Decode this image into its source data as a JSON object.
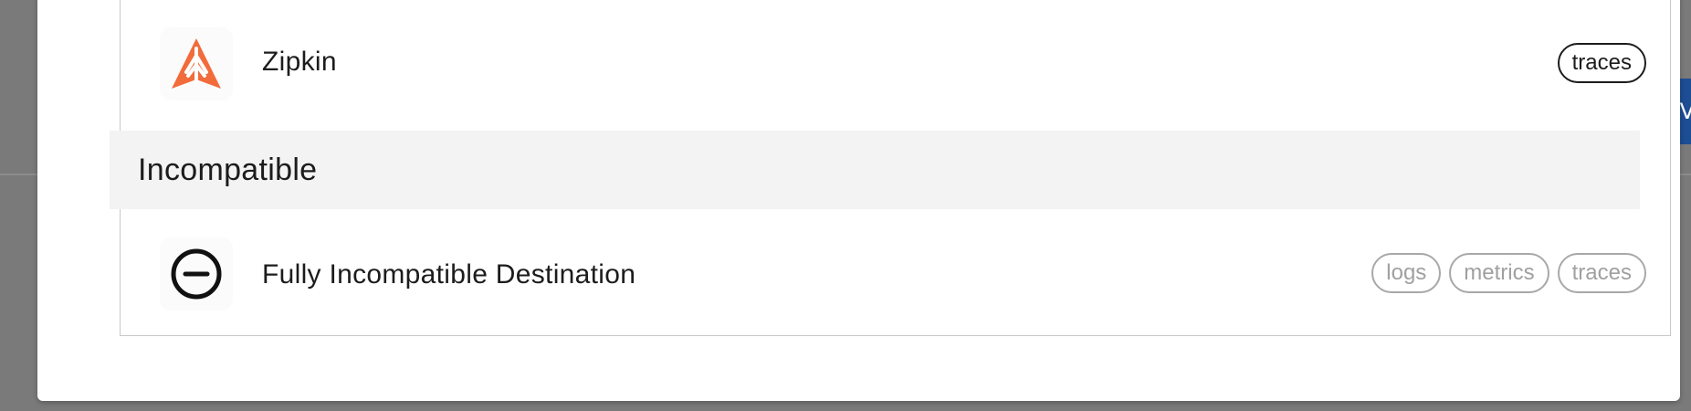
{
  "background": {
    "partial_button_text": "V",
    "accent_color": "#1d4d93"
  },
  "destinations": {
    "compatible_items": [
      {
        "name": "Zipkin",
        "icon": "zipkin-logo-icon",
        "icon_color": "#f26b3a",
        "tags": [
          "traces"
        ]
      }
    ],
    "incompatible_section": {
      "title": "Incompatible",
      "items": [
        {
          "name": "Fully Incompatible Destination",
          "icon": "minus-circle-icon",
          "tags": [
            "logs",
            "metrics",
            "traces"
          ]
        }
      ]
    }
  }
}
